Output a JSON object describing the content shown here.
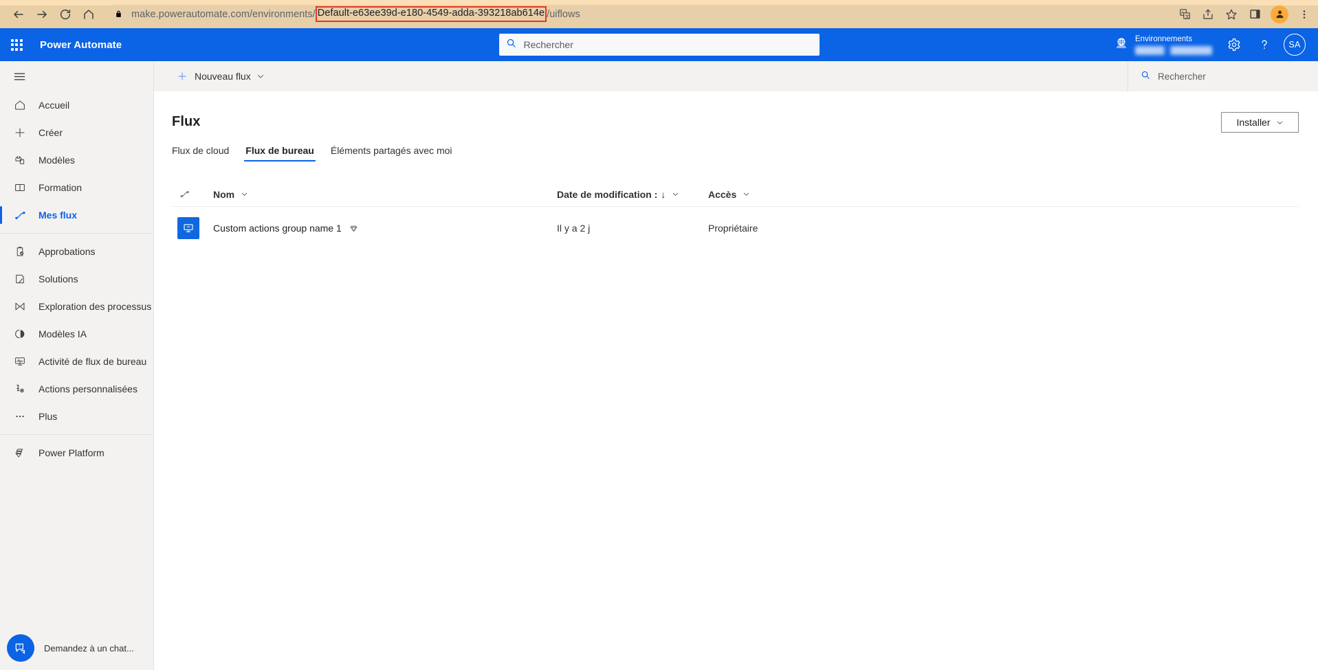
{
  "browser": {
    "url_prefix": "make.powerautomate.com/environments/",
    "url_highlight": "Default-e63ee39d-e180-4549-adda-393218ab614e",
    "url_suffix": "/uiflows",
    "highlight_color": "#e03a25",
    "icons": {
      "back": "back-arrow-icon",
      "forward": "forward-arrow-icon",
      "reload": "reload-icon",
      "home": "home-icon",
      "lock": "lock-icon",
      "translate": "translate-icon",
      "share": "share-icon",
      "bookmark": "star-icon",
      "sidepanel": "side-panel-icon",
      "profile": "profile-avatar-icon",
      "menu": "kebab-menu-icon"
    }
  },
  "header": {
    "brand": "Power Automate",
    "search_placeholder": "Rechercher",
    "env_label": "Environnements",
    "env_name": "",
    "avatar_initials": "SA",
    "brand_color": "#0b63e5"
  },
  "sidebar": {
    "items": [
      {
        "label": "Accueil",
        "icon": "home-icon",
        "selected": false
      },
      {
        "label": "Créer",
        "icon": "plus-icon",
        "selected": false
      },
      {
        "label": "Modèles",
        "icon": "templates-icon",
        "selected": false
      },
      {
        "label": "Formation",
        "icon": "book-icon",
        "selected": false
      },
      {
        "label": "Mes flux",
        "icon": "flow-icon",
        "selected": true
      },
      {
        "label": "Approbations",
        "icon": "approvals-icon",
        "selected": false
      },
      {
        "label": "Solutions",
        "icon": "solutions-icon",
        "selected": false
      },
      {
        "label": "Exploration des processus",
        "icon": "process-mining-icon",
        "selected": false
      },
      {
        "label": "Modèles IA",
        "icon": "ai-models-icon",
        "selected": false
      },
      {
        "label": "Activité de flux de bureau",
        "icon": "desktop-activity-icon",
        "selected": false
      },
      {
        "label": "Actions personnalisées",
        "icon": "custom-actions-icon",
        "selected": false
      },
      {
        "label": "Plus",
        "icon": "ellipsis-icon",
        "selected": false
      },
      {
        "label": "Power Platform",
        "icon": "power-platform-icon",
        "selected": false
      }
    ],
    "chat_label": "Demandez à un chat..."
  },
  "command_bar": {
    "new_flow_label": "Nouveau flux",
    "search_placeholder": "Rechercher"
  },
  "main": {
    "page_title": "Flux",
    "install_label": "Installer",
    "tabs": [
      {
        "label": "Flux de cloud",
        "active": false
      },
      {
        "label": "Flux de bureau",
        "active": true
      },
      {
        "label": "Éléments partagés avec moi",
        "active": false
      }
    ],
    "table": {
      "columns": {
        "name": "Nom",
        "modified": "Date de modification :",
        "access": "Accès"
      },
      "sort_arrow": "↓",
      "rows": [
        {
          "name": "Custom actions group name 1",
          "modified": "Il y a 2 j",
          "access": "Propriétaire",
          "premium": true
        }
      ]
    }
  }
}
